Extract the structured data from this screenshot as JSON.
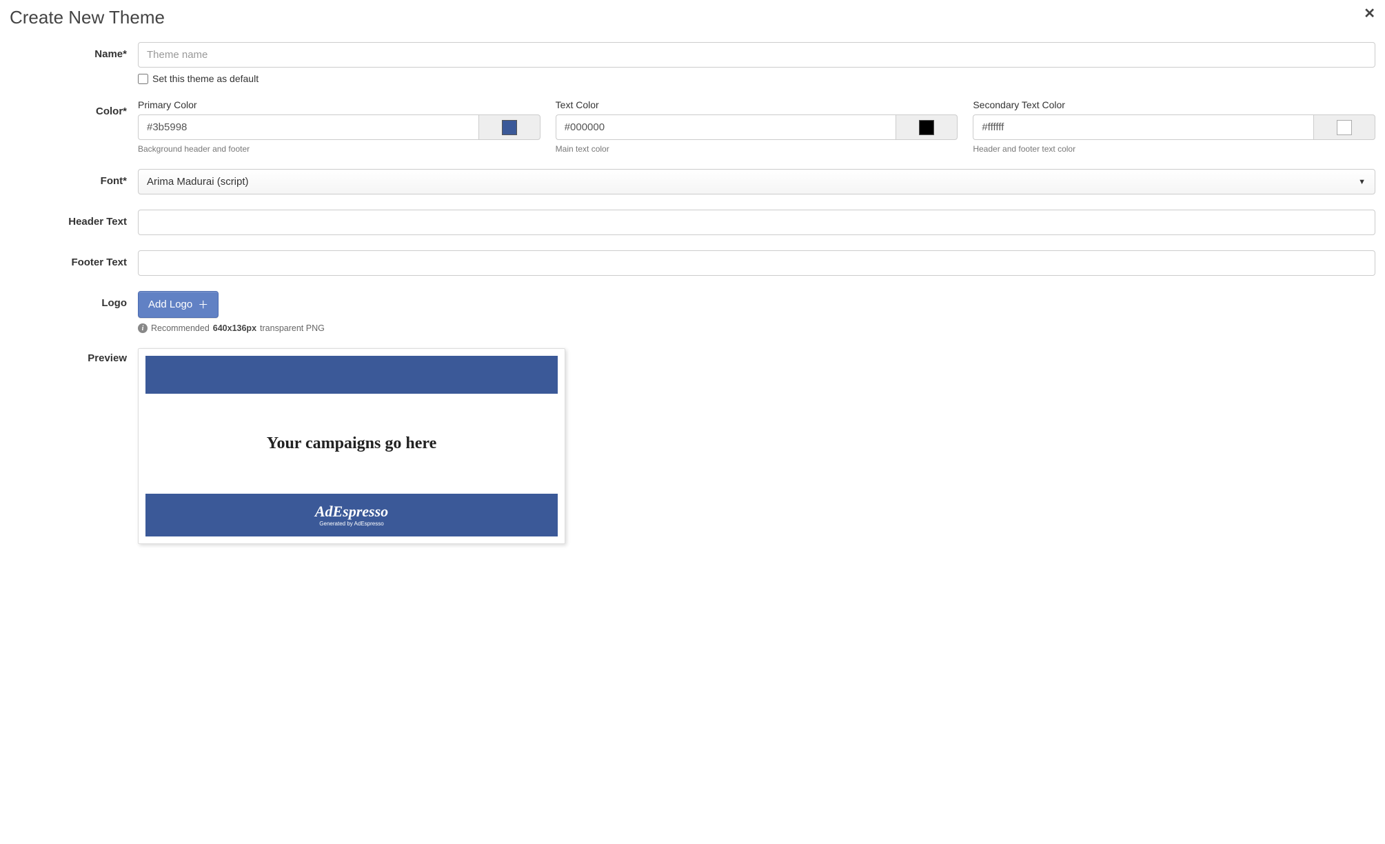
{
  "modal": {
    "title": "Create New Theme",
    "close_label": "✕"
  },
  "name": {
    "label": "Name*",
    "placeholder": "Theme name",
    "value": "",
    "default_checkbox_label": "Set this theme as default"
  },
  "color": {
    "label": "Color*",
    "primary": {
      "label": "Primary Color",
      "value": "#3b5998",
      "hint": "Background header and footer"
    },
    "text": {
      "label": "Text Color",
      "value": "#000000",
      "hint": "Main text color"
    },
    "secondary_text": {
      "label": "Secondary Text Color",
      "value": "#ffffff",
      "hint": "Header and footer text color"
    }
  },
  "font": {
    "label": "Font*",
    "value": "Arima Madurai (script)"
  },
  "header_text": {
    "label": "Header Text",
    "value": ""
  },
  "footer_text": {
    "label": "Footer Text",
    "value": ""
  },
  "logo": {
    "label": "Logo",
    "button_label": "Add Logo",
    "hint_prefix": "Recommended ",
    "hint_size": "640x136px",
    "hint_suffix": " transparent PNG"
  },
  "preview": {
    "label": "Preview",
    "body_text": "Your campaigns go here",
    "footer_logo": "AdEspresso",
    "footer_sub": "Generated by AdEspresso"
  }
}
